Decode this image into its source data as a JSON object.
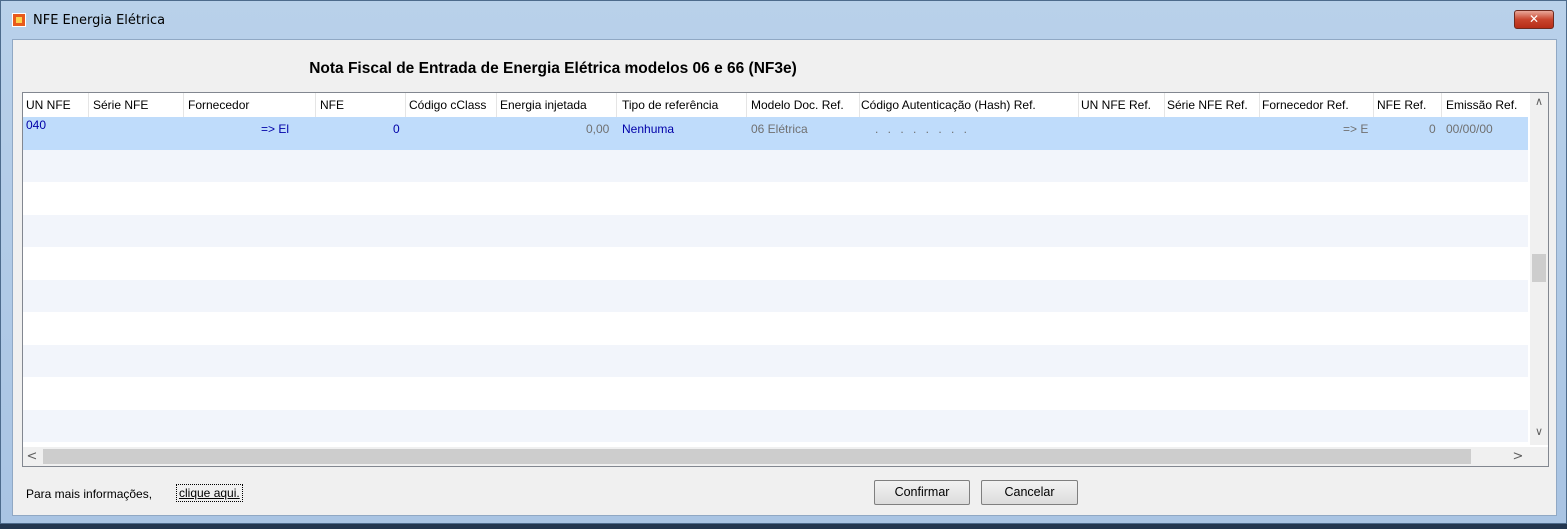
{
  "window": {
    "title": "NFE Energia Elétrica",
    "close_glyph": "✕"
  },
  "header": {
    "title": "Nota Fiscal de Entrada de Energia Elétrica modelos 06 e 66 (NF3e)"
  },
  "table": {
    "columns": [
      "UN NFE",
      "Série NFE",
      "Fornecedor",
      "NFE",
      "Código cClass",
      "Energia injetada",
      "Tipo de referência",
      "Modelo Doc. Ref.",
      "Código Autenticação (Hash) Ref.",
      "UN NFE Ref.",
      "Série NFE Ref.",
      "Fornecedor Ref.",
      "NFE Ref.",
      "Emissão Ref."
    ],
    "selected_row": {
      "un_nfe": "040",
      "fornecedor": "=> El",
      "nfe": "0",
      "energia_injetada": "0,00",
      "tipo_referencia": "Nenhuma",
      "modelo_doc_ref": "06 Elétrica",
      "hash_ref": ". . . . . . . .",
      "fornecedor_ref": "=> E",
      "nfe_ref": "0",
      "emissao_ref": "00/00/00"
    }
  },
  "scroll": {
    "up": "∧",
    "down": "∨",
    "left": "<",
    "right": ">"
  },
  "footer": {
    "info_text": "Para mais informações,",
    "info_link": "clique aqui.",
    "confirm_label": "Confirmar",
    "cancel_label": "Cancelar"
  },
  "colors": {
    "selection": "#bfdcfb",
    "blue_text": "#0000a8",
    "gray_text": "#707070"
  }
}
